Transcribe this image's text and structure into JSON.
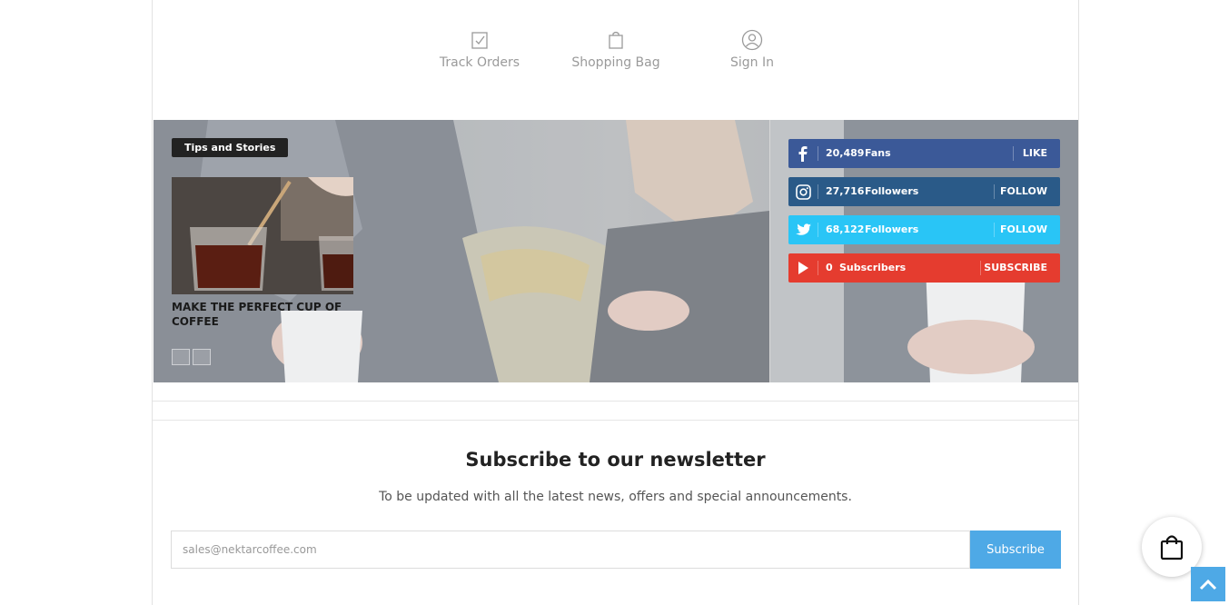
{
  "header": {
    "links": [
      {
        "label": "Track Orders",
        "icon": "clipboard-check-icon"
      },
      {
        "label": "Shopping Bag",
        "icon": "shopping-bag-icon"
      },
      {
        "label": "Sign In",
        "icon": "user-circle-icon"
      }
    ]
  },
  "blog": {
    "badge": "Tips and Stories",
    "post_title": "MAKE THE PERFECT CUP OF COFFEE"
  },
  "social": [
    {
      "network": "facebook",
      "count": "20,489",
      "unit": "Fans",
      "action": "LIKE",
      "color": "#3b5998"
    },
    {
      "network": "instagram",
      "count": "27,716",
      "unit": "Followers",
      "action": "FOLLOW",
      "color": "#2a5a88"
    },
    {
      "network": "twitter",
      "count": "68,122",
      "unit": "Followers",
      "action": "FOLLOW",
      "color": "#29c5f6"
    },
    {
      "network": "youtube",
      "count": "0",
      "unit": "Subscribers",
      "action": "SUBSCRIBE",
      "color": "#e53c2f"
    }
  ],
  "newsletter": {
    "title": "Subscribe to our newsletter",
    "subtitle": "To be updated with all the latest news, offers and special announcements.",
    "placeholder": "sales@nektarcoffee.com",
    "button": "Subscribe"
  },
  "colors": {
    "accent": "#4ea9e6",
    "muted_text": "#9a9a9a"
  }
}
